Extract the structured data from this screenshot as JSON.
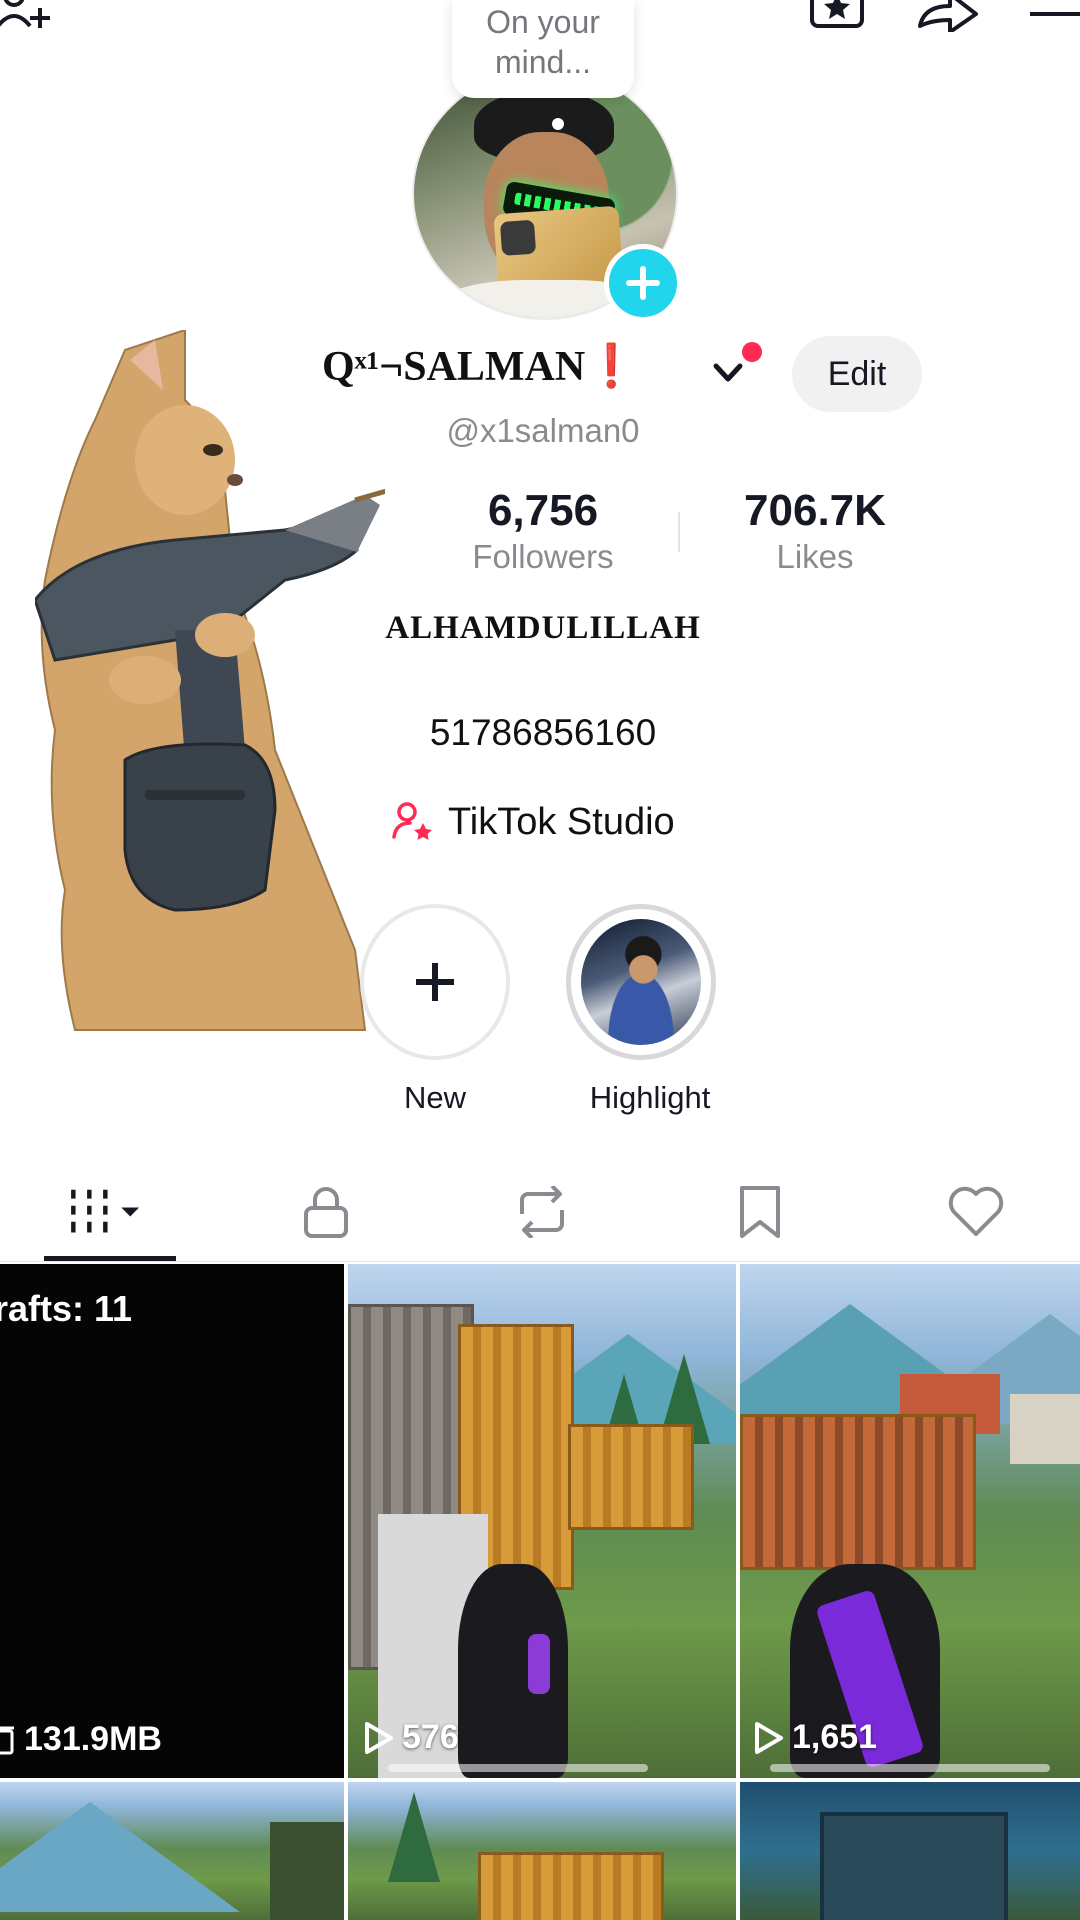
{
  "top_bar": {
    "icons": [
      "add-friend-icon",
      "favorites-icon",
      "share-icon",
      "menu-icon"
    ]
  },
  "profile": {
    "note_bubble": "On your mind...",
    "display_name_main": "Qˣ¹¬SALMAN",
    "display_name_mark": "❗",
    "username": "@x1salman0",
    "edit_label": "Edit",
    "stats": [
      {
        "value": "6,756",
        "label": "Followers"
      },
      {
        "value": "706.7K",
        "label": "Likes"
      }
    ],
    "bio_line1": "ALHAMDULILLAH",
    "bio_line2": "51786856160",
    "studio_label": "TikTok Studio"
  },
  "highlights": [
    {
      "label": "New"
    },
    {
      "label": "Highlight"
    }
  ],
  "tabs": [
    "videos-grid-icon",
    "private-lock-icon",
    "reposts-icon",
    "saved-bookmark-icon",
    "liked-heart-icon"
  ],
  "grid": {
    "drafts_label": "rafts: 11",
    "drafts_size": "131.9MB",
    "videos": [
      {
        "views": "576"
      },
      {
        "views": "1,651"
      }
    ]
  },
  "colors": {
    "accent_cyan": "#20d5ec",
    "accent_pink": "#fe2c55",
    "text_primary": "#161823",
    "text_secondary": "#8a8b91"
  }
}
